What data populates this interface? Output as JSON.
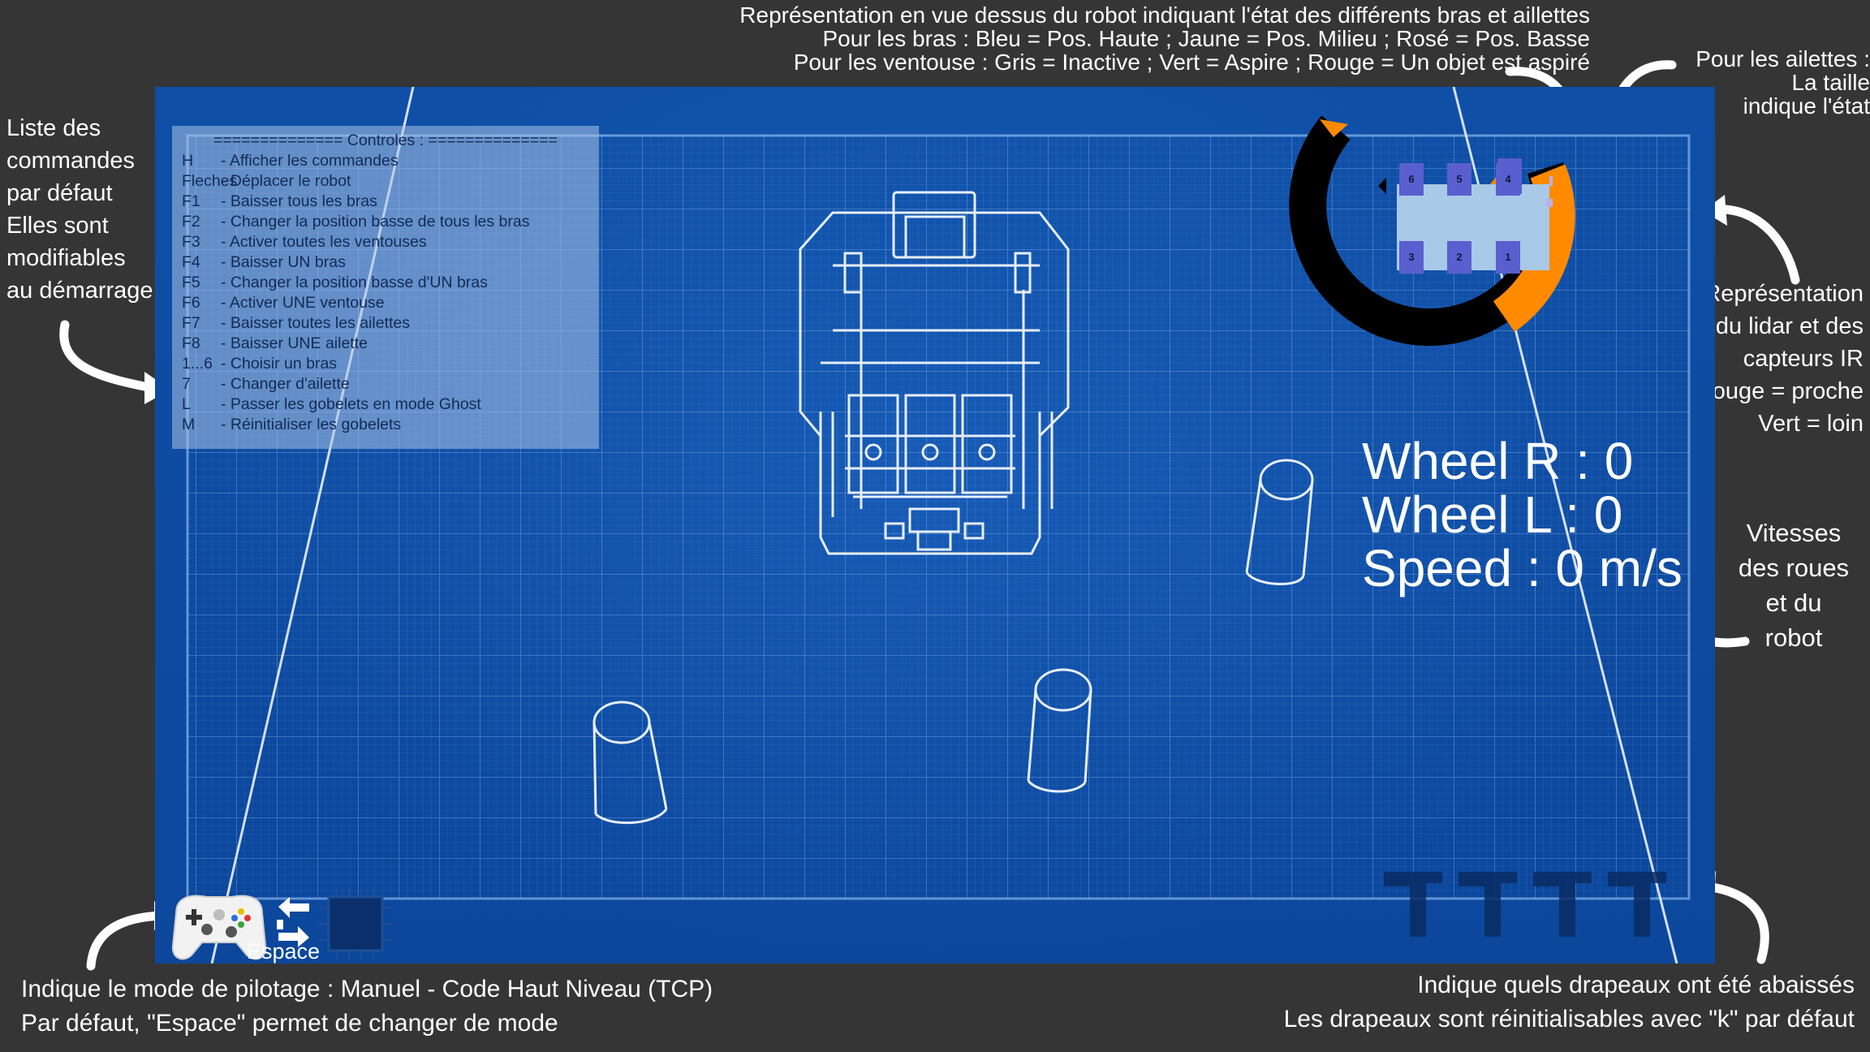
{
  "annotations": {
    "top_center": [
      "Représentation en vue dessus du robot indiquant l'état des différents bras et aillettes",
      "Pour les bras : Bleu = Pos. Haute ; Jaune = Pos. Milieu ; Rosé = Pos. Basse",
      "Pour les ventouse : Gris = Inactive ; Vert = Aspire ; Rouge = Un objet est aspiré"
    ],
    "top_right": [
      "Pour les ailettes :",
      "La taille",
      "indique l'état"
    ],
    "left": [
      "Liste des",
      "commandes",
      "par défaut",
      "Elles sont",
      "modifiables",
      "au démarrage"
    ],
    "right_lidar": [
      "Représentation",
      "du lidar et des",
      "capteurs IR",
      "Rouge = proche",
      "Vert = loin"
    ],
    "right_speed": [
      "Vitesses",
      "des roues",
      "et du",
      "robot"
    ],
    "bottom_left": [
      "Indique le mode de pilotage : Manuel - Code Haut Niveau (TCP)",
      "Par défaut, \"Espace\" permet de changer de mode"
    ],
    "bottom_right": [
      "Indique quels drapeaux ont été abaissés",
      "Les drapeaux sont réinitialisables avec \"k\" par défaut"
    ]
  },
  "controls": {
    "title": "============== Controles : ==============",
    "rows": [
      {
        "key": "H",
        "action": "- Afficher les commandes"
      },
      {
        "key": "Fleches",
        "action": "- Déplacer le robot"
      },
      {
        "key": "F1",
        "action": "- Baisser tous les bras"
      },
      {
        "key": "F2",
        "action": "- Changer la position basse de tous les bras"
      },
      {
        "key": "F3",
        "action": "- Activer toutes les ventouses"
      },
      {
        "key": "F4",
        "action": "- Baisser UN bras"
      },
      {
        "key": "F5",
        "action": "- Changer la position basse d'UN bras"
      },
      {
        "key": "F6",
        "action": "- Activer UNE ventouse"
      },
      {
        "key": "F7",
        "action": "- Baisser toutes les ailettes"
      },
      {
        "key": "F8",
        "action": "- Baisser UNE ailette"
      },
      {
        "key": "1...6",
        "action": "- Choisir un bras"
      },
      {
        "key": "7",
        "action": "- Changer d'ailette"
      },
      {
        "key": "L",
        "action": "- Passer les gobelets en mode Ghost"
      },
      {
        "key": "M",
        "action": "- Réinitialiser les gobelets"
      }
    ]
  },
  "stats": {
    "wheel_r": "Wheel R : 0",
    "wheel_l": "Wheel L : 0",
    "speed": "Speed : 0 m/s"
  },
  "robot_topview": {
    "arm_labels": [
      "6",
      "5",
      "4",
      "3",
      "2",
      "1"
    ],
    "arm_color": "#5a5fd0",
    "body_color": "#a9c9e8"
  },
  "lidar": {
    "near_color": "#ff8a00",
    "far_color": "#000000"
  },
  "mode": {
    "key_label": "Espace"
  },
  "flags": {
    "count": 4,
    "lowered": 0
  },
  "colors": {
    "background": "#353535",
    "blueprint": "#0d4a9f"
  }
}
